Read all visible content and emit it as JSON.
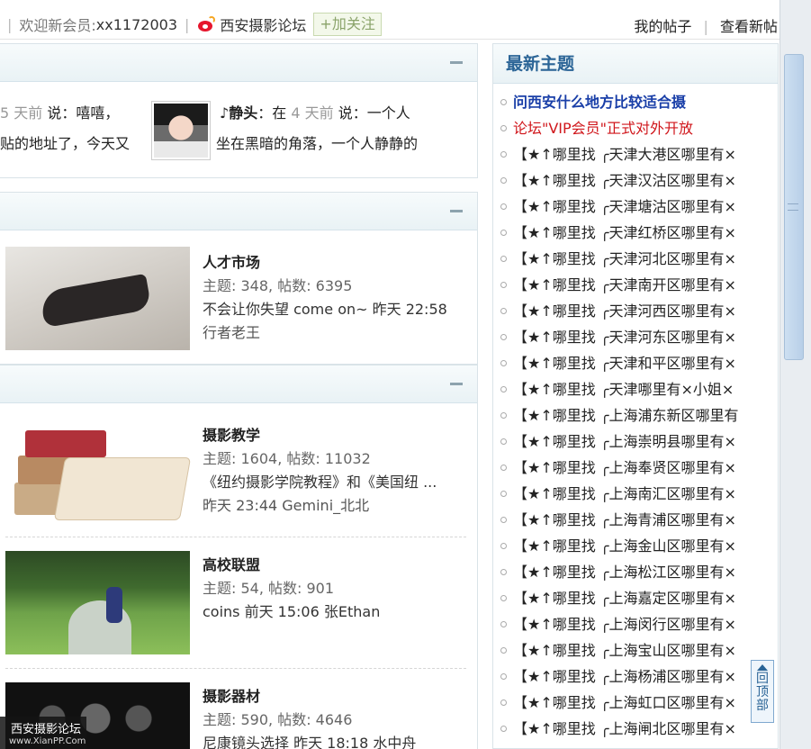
{
  "topbar": {
    "welcome": "欢迎新会员:",
    "username": "xx1172003",
    "forum_name": "西安摄影论坛",
    "follow_label": "+加关注",
    "my_posts": "我的帖子",
    "view_new": "查看新帖"
  },
  "feed": {
    "line1_time": "5 天前",
    "line1_text": "说：嘻嘻，",
    "line2_text": "贴的地址了，今天又",
    "user": "静头",
    "user_prefix": "：在",
    "user_time": "4 天前",
    "user_text": "说：一个人",
    "user_text2": "坐在黑暗的角落，一个人静静的"
  },
  "forums": [
    {
      "name": "人才市场",
      "stats": "主题: 348, 帖数: 6395",
      "last": "不会让你失望 come on~ 昨天 22:58",
      "last2": "行者老王"
    },
    {
      "name": "摄影教学",
      "stats": "主题: 1604, 帖数: 11032",
      "last": "《纽约摄影学院教程》和《美国纽 ...",
      "last2": "昨天 23:44 Gemini_北北"
    },
    {
      "name": "高校联盟",
      "stats": "主题: 54, 帖数: 901",
      "last": "coins 前天 15:06 张Ethan",
      "last2": ""
    },
    {
      "name": "摄影器材",
      "stats": "主题: 590, 帖数: 4646",
      "last": "尼康镜头选择 昨天 18:18 水中舟",
      "last2": ""
    }
  ],
  "sidebar": {
    "title": "最新主题",
    "topics": [
      "问西安什么地方比较适合摄",
      "论坛\"VIP会员\"正式对外开放",
      "【★↑哪里找 ╭天津大港区哪里有×",
      "【★↑哪里找 ╭天津汉沽区哪里有×",
      "【★↑哪里找 ╭天津塘沽区哪里有×",
      "【★↑哪里找 ╭天津红桥区哪里有×",
      "【★↑哪里找 ╭天津河北区哪里有×",
      "【★↑哪里找 ╭天津南开区哪里有×",
      "【★↑哪里找 ╭天津河西区哪里有×",
      "【★↑哪里找 ╭天津河东区哪里有×",
      "【★↑哪里找 ╭天津和平区哪里有×",
      "【★↑哪里找 ╭天津哪里有×小姐×",
      "【★↑哪里找 ╭上海浦东新区哪里有",
      "【★↑哪里找 ╭上海崇明县哪里有×",
      "【★↑哪里找 ╭上海奉贤区哪里有×",
      "【★↑哪里找 ╭上海南汇区哪里有×",
      "【★↑哪里找 ╭上海青浦区哪里有×",
      "【★↑哪里找 ╭上海金山区哪里有×",
      "【★↑哪里找 ╭上海松江区哪里有×",
      "【★↑哪里找 ╭上海嘉定区哪里有×",
      "【★↑哪里找 ╭上海闵行区哪里有×",
      "【★↑哪里找 ╭上海宝山区哪里有×",
      "【★↑哪里找 ╭上海杨浦区哪里有×",
      "【★↑哪里找 ╭上海虹口区哪里有×",
      "【★↑哪里找 ╭上海闸北区哪里有×"
    ]
  },
  "backtop": {
    "label1": "回",
    "label2": "顶",
    "label3": "部"
  },
  "watermark": {
    "line1": "西安摄影论坛",
    "line2": "www.XianPP.Com"
  }
}
